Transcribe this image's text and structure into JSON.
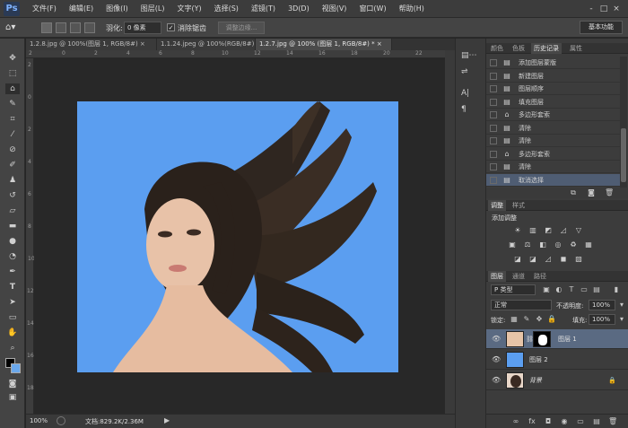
{
  "app": {
    "logo": "Ps",
    "menus": [
      "文件(F)",
      "编辑(E)",
      "图像(I)",
      "图层(L)",
      "文字(Y)",
      "选择(S)",
      "滤镜(T)",
      "3D(D)",
      "视图(V)",
      "窗口(W)",
      "帮助(H)"
    ],
    "window_controls": [
      "-",
      "□",
      "×"
    ]
  },
  "options_bar": {
    "feather_label": "羽化:",
    "feather_value": "0 像素",
    "antialias_label": "消除锯齿",
    "refine_edge": "调整边缘...",
    "workspace": "基本功能"
  },
  "doc_tabs": [
    {
      "label": "1.2.8.jpg @ 100%(图层 1, RGB/8#) ×"
    },
    {
      "label": "1.1.24.jpeg @ 100%(RGB/8#) ×"
    },
    {
      "label": "1.2.7.jpg @ 100% (图层 1, RGB/8#) * ×"
    }
  ],
  "rulers": {
    "top": [
      "2",
      "0",
      "2",
      "4",
      "6",
      "8",
      "10",
      "12",
      "14",
      "16",
      "18",
      "20",
      "22"
    ],
    "left": [
      "2",
      "0",
      "2",
      "4",
      "6",
      "8",
      "10",
      "12",
      "14",
      "16",
      "18"
    ]
  },
  "status": {
    "zoom": "100%",
    "doc_info": "文档:829.2K/2.36M"
  },
  "history_panel": {
    "tabs": [
      "颜色",
      "色板",
      "历史记录",
      "属性"
    ],
    "items": [
      {
        "label": "添加图层蒙版",
        "icon": "▤"
      },
      {
        "label": "新建图层",
        "icon": "▤"
      },
      {
        "label": "图层顺序",
        "icon": "▤"
      },
      {
        "label": "填充图层",
        "icon": "▤"
      },
      {
        "label": "多边形套索",
        "icon": "⌂"
      },
      {
        "label": "清除",
        "icon": "▤"
      },
      {
        "label": "清除",
        "icon": "▤"
      },
      {
        "label": "多边形套索",
        "icon": "⌂"
      },
      {
        "label": "清除",
        "icon": "▤"
      },
      {
        "label": "取消选择",
        "icon": "▤"
      }
    ],
    "selected_index": 9
  },
  "adjust_panel": {
    "tabs": [
      "调整",
      "样式"
    ],
    "title": "添加调整",
    "row1_icons": [
      "☀",
      "▥",
      "◩",
      "◿",
      "▽"
    ],
    "row2_icons": [
      "▣",
      "⚖",
      "◧",
      "◎",
      "♻",
      "▦"
    ],
    "row3_icons": [
      "◪",
      "◪",
      "◿",
      "◼",
      "▧"
    ]
  },
  "layers_panel": {
    "tabs": [
      "图层",
      "通道",
      "路径"
    ],
    "filter_label": "P 类型",
    "blend_mode": "正常",
    "opacity_label": "不透明度:",
    "opacity_value": "100%",
    "lock_label": "锁定:",
    "fill_label": "填充:",
    "fill_value": "100%",
    "layers": [
      {
        "name": "图层 1",
        "selected": true
      },
      {
        "name": "图层 2",
        "selected": false
      },
      {
        "name": "背景",
        "selected": false
      }
    ],
    "bottom_icons": [
      "∞",
      "fx",
      "◘",
      "◉",
      "▭",
      "▤",
      "🗑"
    ]
  },
  "colors": {
    "canvas_bg": "#5b9ef0",
    "layer2_fill": "#5b9ef0"
  }
}
